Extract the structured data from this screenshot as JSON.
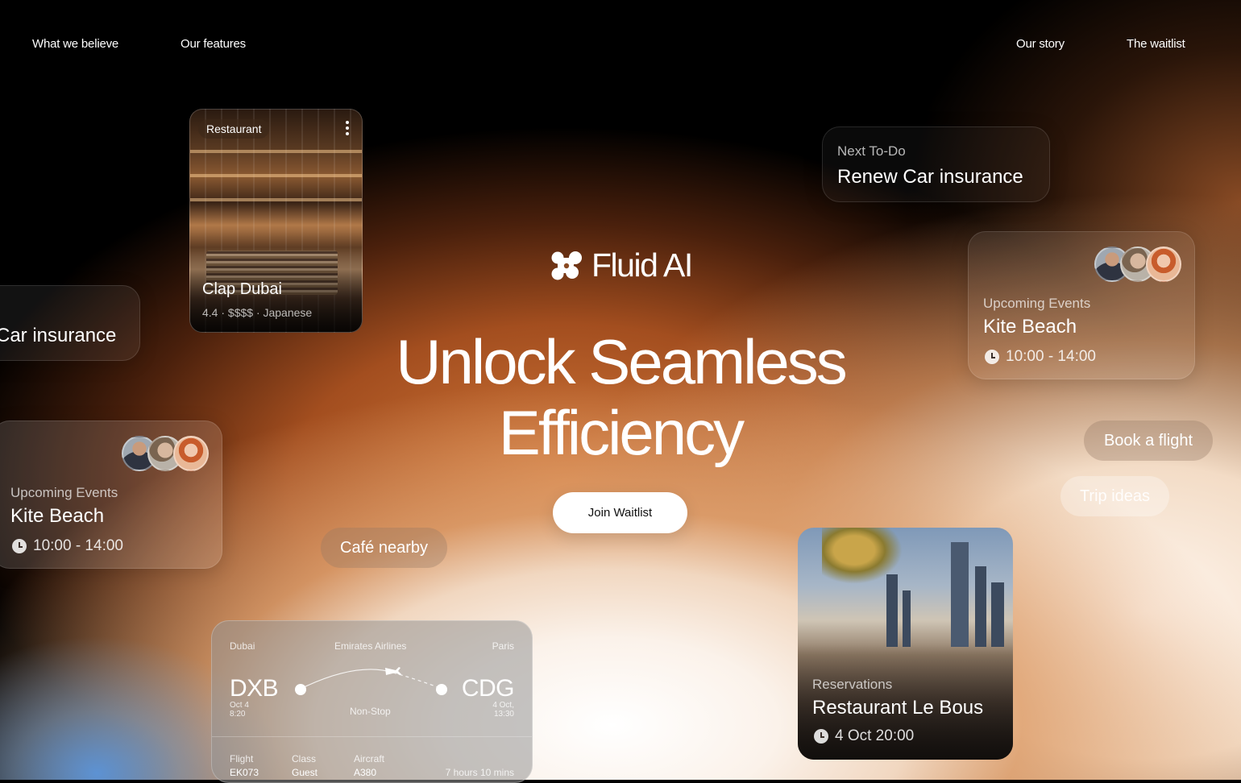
{
  "nav": {
    "left": [
      "What we believe",
      "Our features"
    ],
    "right": [
      "Our story",
      "The waitlist"
    ]
  },
  "brand": {
    "name": "Fluid AI",
    "icon": "fluid-logo-icon"
  },
  "hero": {
    "line1": "Unlock Seamless",
    "line2": "Efficiency",
    "cta": "Join Waitlist"
  },
  "restaurant_card": {
    "tag": "Restaurant",
    "name": "Clap Dubai",
    "details": "4.4 · $$$$ · Japanese"
  },
  "todo_card": {
    "label": "Next To-Do",
    "title": "Renew Car insurance"
  },
  "todo_card_partial": {
    "title": "Car insurance"
  },
  "events_card_right": {
    "label": "Upcoming Events",
    "title": "Kite Beach",
    "time": "10:00 - 14:00"
  },
  "events_card_left": {
    "label": "Upcoming Events",
    "title": "Kite Beach",
    "time": "10:00 - 14:00"
  },
  "pills": {
    "book_flight": "Book a flight",
    "trip_ideas": "Trip ideas",
    "cafe_nearby": "Café nearby"
  },
  "reservation_card": {
    "label": "Reservations",
    "title": "Restaurant Le Bous",
    "time": "4 Oct 20:00"
  },
  "flight_card": {
    "from_city": "Dubai",
    "airline": "Emirates Airlines",
    "to_city": "Paris",
    "from_code": "DXB",
    "to_code": "CDG",
    "from_date": "Oct 4",
    "from_time": "8:20",
    "to_date": "4 Oct,",
    "to_time": "13:30",
    "stop": "Non-Stop",
    "flight_label": "Flight",
    "flight_value": "EK073",
    "class_label": "Class",
    "class_value": "Guest",
    "aircraft_label": "Aircraft",
    "aircraft_value": "A380",
    "duration": "7 hours 10 mins"
  },
  "colors": {
    "accent_orange": "#c8682c",
    "background": "#000000",
    "cta_bg": "#ffffff"
  }
}
